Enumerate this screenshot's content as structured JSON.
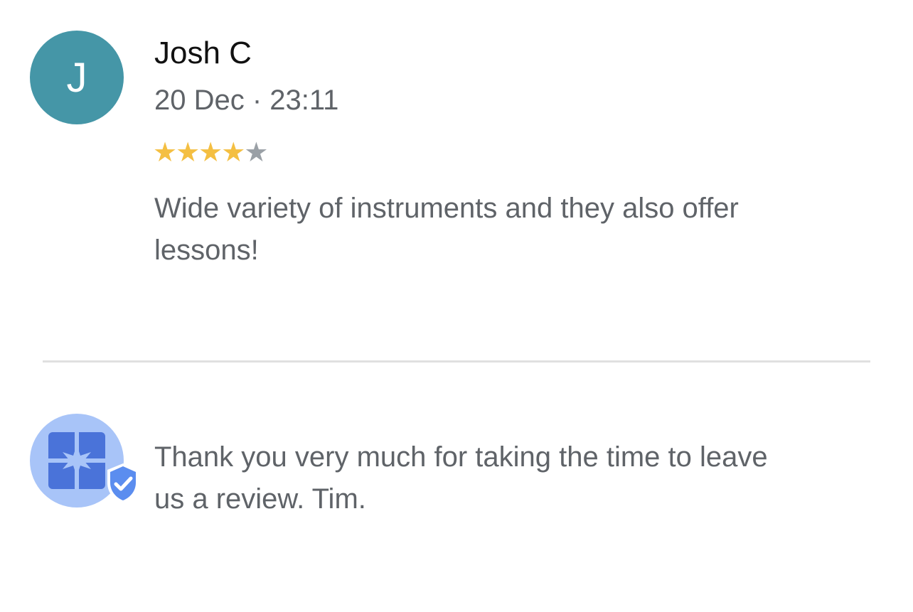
{
  "review": {
    "avatar_initial": "J",
    "author_name": "Josh C",
    "date": "20 Dec · 23:11",
    "rating": 4,
    "rating_max": 5,
    "text": "Wide variety of instruments and they also offer lessons!",
    "colors": {
      "avatar_bg": "#4596a7",
      "star_filled": "#f4bf42",
      "star_empty": "#9aa0a6"
    }
  },
  "owner_reply": {
    "avatar_icon": "store-icon",
    "badge_icon": "verified-shield-icon",
    "text": "Thank you very much for taking the time to leave us a review. Tim.",
    "colors": {
      "avatar_bg": "#a8c4f8",
      "icon": "#4a73d9",
      "badge": "#5b8def"
    }
  }
}
